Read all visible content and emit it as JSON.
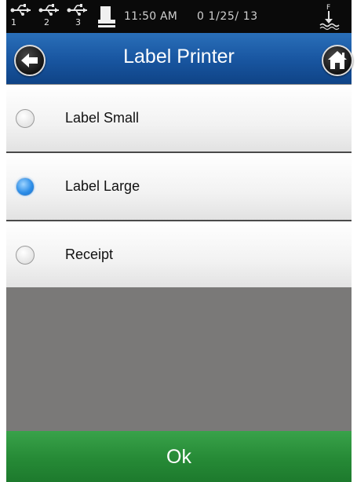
{
  "status_bar": {
    "usb_ports": [
      {
        "icon": "usb-icon",
        "number": "1"
      },
      {
        "icon": "usb-icon",
        "number": "2"
      },
      {
        "icon": "usb-icon",
        "number": "3"
      }
    ],
    "printer_icon": "printer-icon",
    "time": "11:50 AM",
    "date": "0 1/25/ 13",
    "right_icon": "ship-anchor-icon",
    "right_icon_letter": "F"
  },
  "header": {
    "title": "Label Printer",
    "back_icon": "back-arrow-icon",
    "home_icon": "home-icon",
    "color": "#1a5aa5"
  },
  "options": [
    {
      "label": "Label Small",
      "selected": false
    },
    {
      "label": "Label Large",
      "selected": true
    },
    {
      "label": "Receipt",
      "selected": false
    }
  ],
  "footer": {
    "ok_label": "Ok",
    "color": "#2a9140"
  },
  "colors": {
    "selected_radio": "#2d8ee8",
    "background_gray": "#7a7978"
  }
}
